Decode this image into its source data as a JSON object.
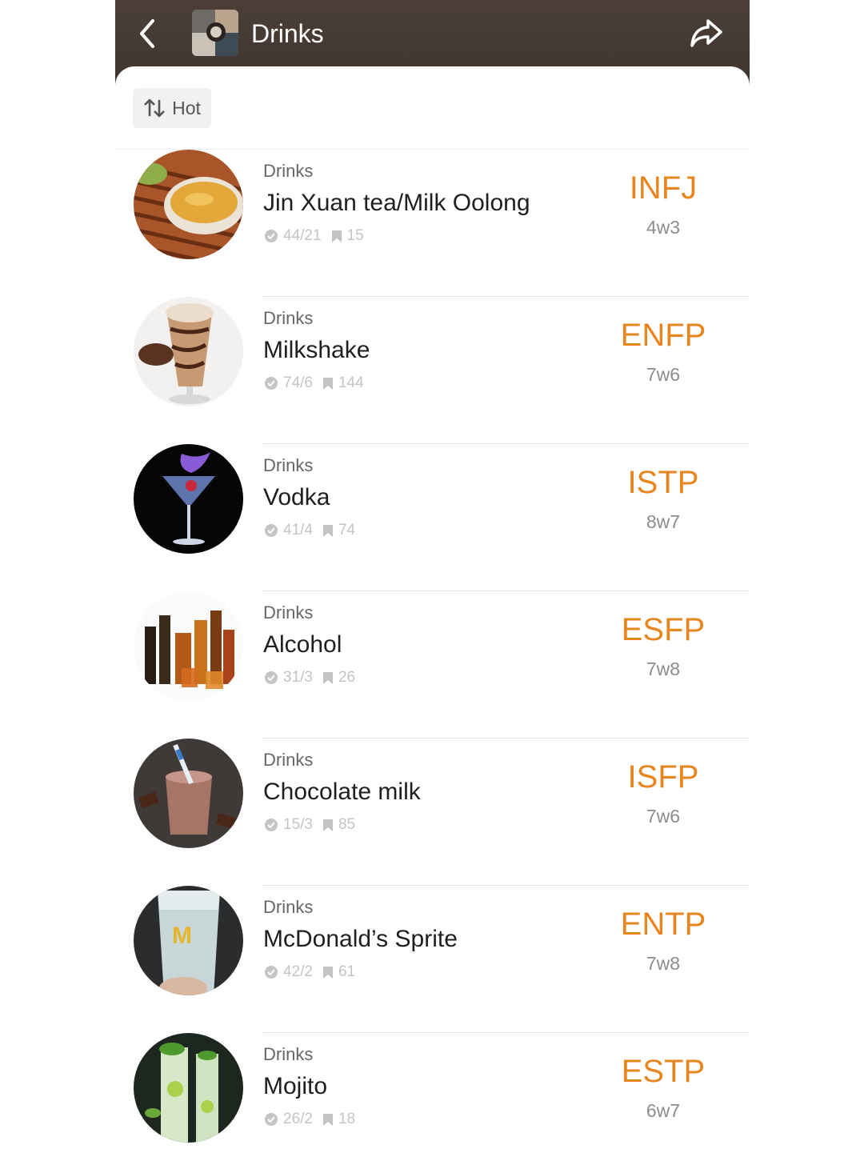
{
  "header": {
    "title": "Drinks",
    "back_icon": "chevron-left-icon",
    "share_icon": "share-icon"
  },
  "sort": {
    "label": "Hot",
    "icon": "sort-icon"
  },
  "colors": {
    "accent": "#e9851f",
    "header_bg": "#463b34"
  },
  "items": [
    {
      "category": "Drinks",
      "name": "Jin Xuan tea/Milk Oolong",
      "votes": "44/21",
      "saves": "15",
      "mbti": "INFJ",
      "wing": "4w3"
    },
    {
      "category": "Drinks",
      "name": "Milkshake",
      "votes": "74/6",
      "saves": "144",
      "mbti": "ENFP",
      "wing": "7w6"
    },
    {
      "category": "Drinks",
      "name": "Vodka",
      "votes": "41/4",
      "saves": "74",
      "mbti": "ISTP",
      "wing": "8w7"
    },
    {
      "category": "Drinks",
      "name": "Alcohol",
      "votes": "31/3",
      "saves": "26",
      "mbti": "ESFP",
      "wing": "7w8"
    },
    {
      "category": "Drinks",
      "name": "Chocolate milk",
      "votes": "15/3",
      "saves": "85",
      "mbti": "ISFP",
      "wing": "7w6"
    },
    {
      "category": "Drinks",
      "name": "McDonald’s Sprite",
      "votes": "42/2",
      "saves": "61",
      "mbti": "ENTP",
      "wing": "7w8"
    },
    {
      "category": "Drinks",
      "name": "Mojito",
      "votes": "26/2",
      "saves": "18",
      "mbti": "ESTP",
      "wing": "6w7"
    }
  ]
}
